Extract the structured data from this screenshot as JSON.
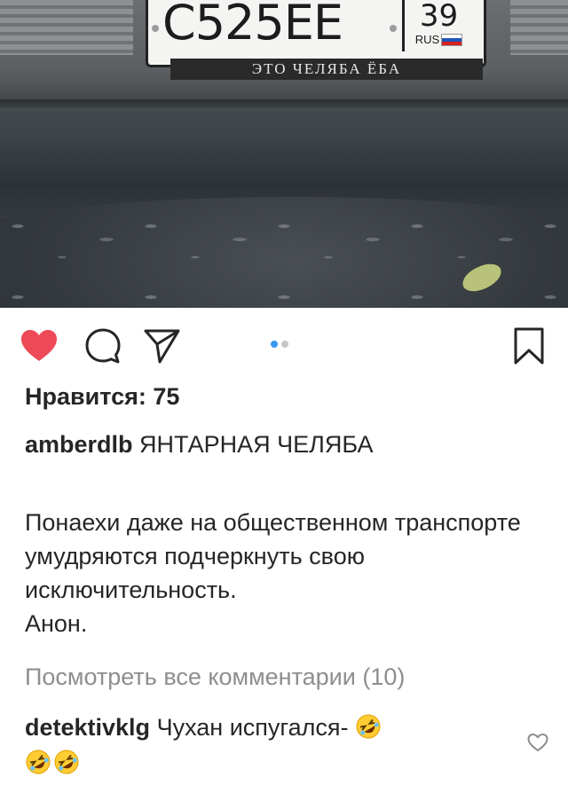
{
  "photo": {
    "plate_number": "С525ЕЕ",
    "plate_region": "39",
    "plate_country": "RUS",
    "frame_text": "ЭТО ЧЕЛЯБА ЁБА"
  },
  "actions": {
    "like_icon": "heart-filled-icon",
    "comment_icon": "comment-icon",
    "share_icon": "paper-plane-icon",
    "save_icon": "bookmark-icon",
    "like_color": "#ed4956",
    "carousel_dots": [
      {
        "state": "active",
        "color": "#3897f0"
      },
      {
        "state": "inactive",
        "color": "#c7c7c7"
      }
    ]
  },
  "post": {
    "likes_label": "Нравится: 75",
    "author": "amberdlb",
    "caption_title": "ЯНТАРНАЯ ЧЕЛЯБА",
    "body_lines": [
      "Понаехи даже на общественном транспорте умудряются подчеркнуть свою исключительность.",
      "Анон."
    ],
    "view_comments": "Посмотреть все комментарии (10)"
  },
  "comment": {
    "author": "detektivklg",
    "text": "Чухан испугался-",
    "emoji_icon": "rolling-on-floor-laughing-emoji",
    "like_icon": "heart-outline-icon"
  }
}
